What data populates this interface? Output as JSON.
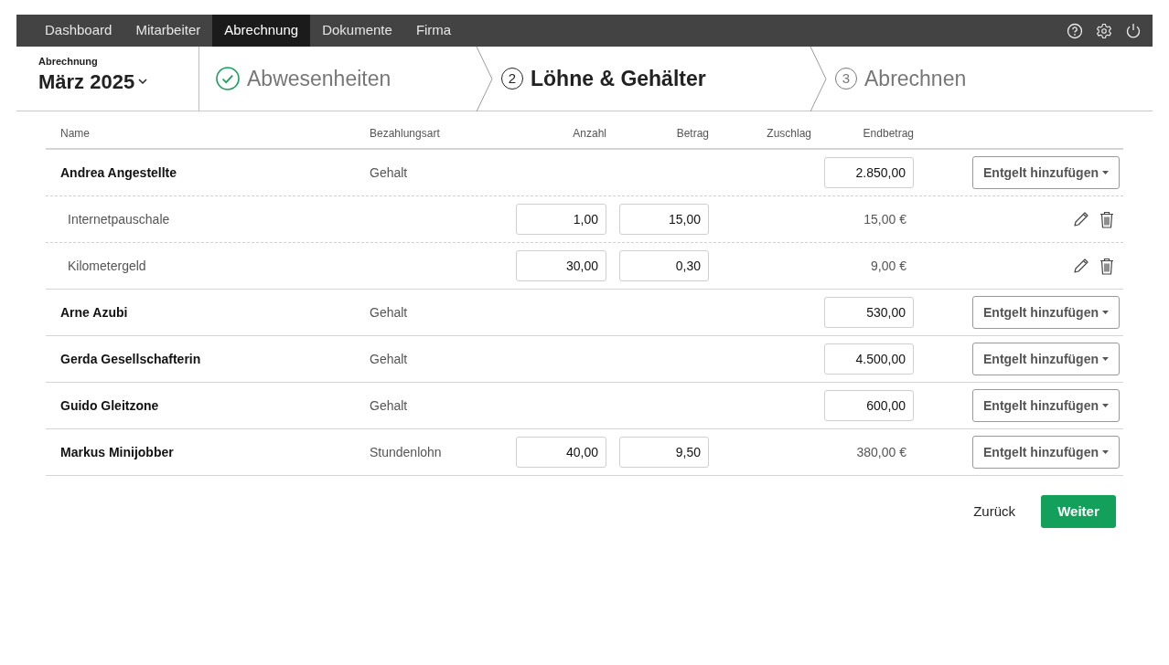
{
  "nav": {
    "items": [
      {
        "label": "Dashboard",
        "selected": false
      },
      {
        "label": "Mitarbeiter",
        "selected": false
      },
      {
        "label": "Abrechnung",
        "selected": true
      },
      {
        "label": "Dokumente",
        "selected": false
      },
      {
        "label": "Firma",
        "selected": false
      }
    ]
  },
  "period": {
    "label": "Abrechnung",
    "value": "März 2025"
  },
  "steps": [
    {
      "label": "Abwesenheiten",
      "done": true,
      "selected": false
    },
    {
      "label": "Löhne & Gehälter",
      "done": false,
      "selected": true,
      "number": "2"
    },
    {
      "label": "Abrechnen",
      "done": false,
      "selected": false,
      "number": "3"
    }
  ],
  "table": {
    "columns": [
      "Name",
      "Bezahlungsart",
      "Anzahl",
      "Betrag",
      "Zuschlag",
      "Endbetrag"
    ],
    "rows": [
      {
        "kind": "employee",
        "name": "Andrea Angestellte",
        "pay_type": "Gehalt",
        "endbetrag": "2.850,00",
        "endbetrag_editable": true,
        "action": "Entgelt hinzufügen"
      },
      {
        "kind": "item",
        "name": "Internetpauschale",
        "anzahl": "1,00",
        "betrag": "15,00",
        "endbetrag": "15,00 €",
        "endbetrag_editable": false
      },
      {
        "kind": "item",
        "name": "Kilometergeld",
        "anzahl": "30,00",
        "betrag": "0,30",
        "endbetrag": "9,00 €",
        "endbetrag_editable": false
      },
      {
        "kind": "employee",
        "name": "Arne Azubi",
        "pay_type": "Gehalt",
        "endbetrag": "530,00",
        "endbetrag_editable": true,
        "action": "Entgelt hinzufügen"
      },
      {
        "kind": "employee",
        "name": "Gerda Gesellschafterin",
        "pay_type": "Gehalt",
        "endbetrag": "4.500,00",
        "endbetrag_editable": true,
        "action": "Entgelt hinzufügen"
      },
      {
        "kind": "employee",
        "name": "Guido Gleitzone",
        "pay_type": "Gehalt",
        "endbetrag": "600,00",
        "endbetrag_editable": true,
        "action": "Entgelt hinzufügen"
      },
      {
        "kind": "employee",
        "name": "Markus Minijobber",
        "pay_type": "Stundenlohn",
        "anzahl": "40,00",
        "betrag": "9,50",
        "endbetrag": "380,00 €",
        "endbetrag_editable": false,
        "action": "Entgelt hinzufügen"
      }
    ]
  },
  "footer": {
    "back": "Zurück",
    "next": "Weiter"
  }
}
